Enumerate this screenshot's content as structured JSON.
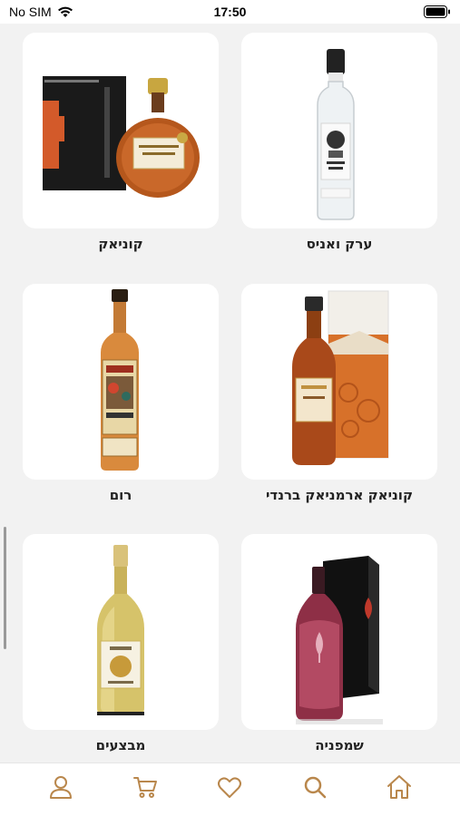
{
  "status_bar": {
    "carrier": "No SIM",
    "time": "17:50"
  },
  "products": [
    {
      "label": "ערק ואניס",
      "image_icon": "arak-bottle-image"
    },
    {
      "label": "קוניאק",
      "image_icon": "cognac-bottle-image"
    },
    {
      "label": "קוניאק ארמניאק ברנדי",
      "image_icon": "brandy-bottle-image"
    },
    {
      "label": "רום",
      "image_icon": "rum-bottle-image"
    },
    {
      "label": "שמפניה",
      "image_icon": "champagne-bottle-image"
    },
    {
      "label": "מבצעים",
      "image_icon": "white-wine-bottle-image"
    }
  ],
  "tab_bar": {
    "tabs": [
      "home-icon",
      "search-icon",
      "heart-icon",
      "cart-icon",
      "user-icon"
    ]
  },
  "colors": {
    "accent": "#b9874c",
    "background": "#f2f2f2",
    "card": "#ffffff"
  }
}
